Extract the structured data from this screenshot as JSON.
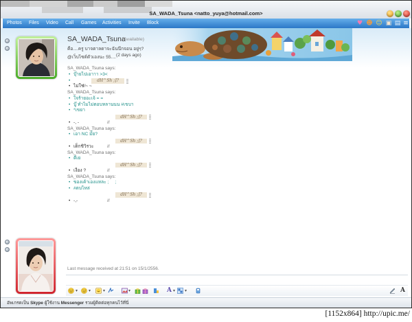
{
  "window": {
    "title": "SA_WADA_Tsuna <natto_yuya@hotmail.com>"
  },
  "menu": {
    "items": [
      {
        "label": "Photos"
      },
      {
        "label": "Files"
      },
      {
        "label": "Video"
      },
      {
        "label": "Call"
      },
      {
        "label": "Games"
      },
      {
        "label": "Activities"
      },
      {
        "label": "Invite"
      },
      {
        "label": "Block"
      }
    ],
    "right_icons": [
      "heart-icon",
      "friend-icon",
      "smiley-icon",
      "background-icon",
      "layout-icon",
      "show-menu-icon"
    ]
  },
  "contact": {
    "name": "SA_WADA_Tsuna",
    "status": "(Available)",
    "personal_message": "คือ....ครู บาจตาลดาจะฉันนึกจอน อยู่ๆ?",
    "recent_post": "@เว็บไซต์ตัวเองนะ 55....",
    "recent_post_time": "(2 days ago)"
  },
  "chat": {
    "my_prefix": "//",
    "blocks": [
      {
        "sender": "SA_WADA_Tsuna says:",
        "messages": [
          "บุ๊ายไปเอาาา >3<"
        ]
      },
      {
        "sender": "dH^Sh ;]?",
        "messages": [
          "ไม่ใช่ ~ ~"
        ]
      },
      {
        "sender": "SA_WADA_Tsuna says:",
        "messages": [
          "ใจร้ายอะเจ้ = =",
          "บู๊ ทำไมไม่ตอบหลานนน #เขบา",
          "*เขยา"
        ]
      },
      {
        "sender": "dH^Sh ;]?",
        "messages": [
          "-, -"
        ]
      },
      {
        "sender": "SA_WADA_Tsuna says:",
        "messages": [
          "เอา NC มั้ย?"
        ]
      },
      {
        "sender": "dH^Sh ;]?",
        "messages": [
          "เด็กชิวิรวะ"
        ]
      },
      {
        "sender": "SA_WADA_Tsuna says:",
        "messages": [
          "ดีเย"
        ]
      },
      {
        "sender": "dH^Sh ;]?",
        "messages": [
          "เงือง ?"
        ]
      },
      {
        "sender": "SA_WADA_Tsuna says:",
        "messages": [
          "ของเค้าเองแหละ ;     ;",
          "#ตบไหล่"
        ]
      },
      {
        "sender": "dH^Sh ;]?",
        "messages": [
          "-,-"
        ]
      }
    ]
  },
  "last_message": "Last message received at 21:51 on 15/1/2556.",
  "toolbar": {
    "icons": [
      "emoticon-icon",
      "wink-icon",
      "sound-emoticon-icon",
      "nudge-icon",
      "share-photo-icon",
      "games-icon",
      "animation-icon",
      "activity-icon",
      "font-icon",
      "background-icon",
      "voice-clip-icon",
      "handwriting-icon",
      "text-mode-icon"
    ]
  },
  "status_bar": {
    "text_1": "อัพเกรดเป็น",
    "brand_1": "Skype",
    "text_2": "ผู้ใช้งาน",
    "brand_2": "Messenger",
    "text_3": "รวมผู้ติดต่อทุกคนไว้ที่นี่"
  },
  "watermark": "[1152x864] http://upic.me/",
  "colors": {
    "menu_bar": "#2b77c7",
    "contact_message": "#1e8f88",
    "contact_frame_available": "#4aab27",
    "self_frame": "#d0242d",
    "my_name_box": "#efe6d5"
  }
}
